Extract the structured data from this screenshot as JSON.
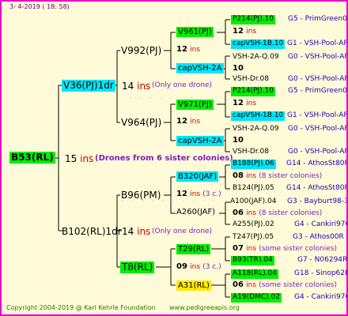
{
  "header": {
    "date": "3-  4-2019  ( 18:  58)"
  },
  "footer": {
    "copyright": "Copyright 2004-2019 @ Karl Kehrle Foundation",
    "url": "www.pedigreeapis.org"
  },
  "root": {
    "id": "B53(RL)",
    "ins_num": "15",
    "ins": "ins",
    "note": "(Drones from 6 sister colonies)"
  },
  "gen1": [
    {
      "id": "V36(PJ)1dr",
      "ins_num": "14",
      "ins": "ins",
      "note": "(Only one drone)"
    },
    {
      "id": "B102(RL)1dr",
      "ins_num": "14",
      "ins": "ins",
      "note": "(Only one drone)"
    }
  ],
  "gen2": [
    {
      "id": "V992(PJ)"
    },
    {
      "id": "V964(PJ)"
    },
    {
      "id": "B96(PM)"
    },
    {
      "id": "T8(RL)"
    }
  ],
  "gen3": [
    {
      "id": "V961(PJ)",
      "ins_num": "12",
      "ins": "ins"
    },
    {
      "id": "capVSH-2A",
      "ins_num": "10"
    },
    {
      "id": "V971(PJ)",
      "ins_num": "12",
      "ins": "ins"
    },
    {
      "id": "capVSH-2A",
      "ins_num": "10"
    },
    {
      "id": "B320(JAF)",
      "ins_num": "12",
      "ins": "ins",
      "note": "(3 c.)"
    },
    {
      "id": "A260(JAF)"
    },
    {
      "id": "T29(RL)",
      "ins_num": "09",
      "ins": "ins",
      "note": "(3 c.)"
    },
    {
      "id": "A31(RL)"
    }
  ],
  "gen4": [
    {
      "id": "P214(PJ).10",
      "line": "G5 - PrimGreen00"
    },
    {
      "id": "12",
      "ins": "ins"
    },
    {
      "id": "capVSH-1B.10",
      "line": "G1 - VSH-Pool-AR"
    },
    {
      "id": "VSH-2A-Q.09",
      "line": "G0 - VSH-Pool-AR"
    },
    {
      "id": "10"
    },
    {
      "id": "VSH-Dr.08",
      "line": "G0 - VSH-Pool-AR"
    },
    {
      "id": "P214(PJ).10",
      "line": "G5 - PrimGreen00"
    },
    {
      "id": "12",
      "ins": "ins"
    },
    {
      "id": "capVSH-1B.10",
      "line": "G1 - VSH-Pool-AR"
    },
    {
      "id": "VSH-2A-Q.09",
      "line": "G0 - VSH-Pool-AR"
    },
    {
      "id": "10"
    },
    {
      "id": "VSH-Dr.08",
      "line": "G0 - VSH-Pool-AR"
    },
    {
      "id": "B188(PJ).06",
      "line": "G14 - AthosSt80R"
    },
    {
      "id": "08",
      "ins": "ins",
      "note": "(8 sister colonies)"
    },
    {
      "id": "B124(PJ).05",
      "line": "G14 - AthosSt80R"
    },
    {
      "id": "A100(JAF).04",
      "line": "G3 - Bayburt98-3"
    },
    {
      "id": "06",
      "ins": "ins",
      "note": "(8 sister colonies)"
    },
    {
      "id": "A255(PJ).02",
      "line": "G4 - Cankiri97Q"
    },
    {
      "id": "T247(PJ).05",
      "line": "G3 - Athos00R"
    },
    {
      "id": "07",
      "ins": "ins",
      "note": "(some sister colonies)"
    },
    {
      "id": "B93(TR).04",
      "line": "G7 - N06294R"
    },
    {
      "id": "A118(RL).04",
      "line": "G18 - Sinop62R"
    },
    {
      "id": "06",
      "ins": "ins",
      "note": "(some sister colonies)"
    },
    {
      "id": "A19(DMC).02",
      "line": "G4 - Cankiri97Q"
    }
  ],
  "colors": {
    "frame": "#e800c8",
    "background": "#fffbd8",
    "green": "#00ee00",
    "cyan": "#00e5f5",
    "yellow": "#ffe800",
    "ins_red": "#d10000",
    "line_blue": "#2000b8",
    "note_purple": "#7a1ec0"
  }
}
